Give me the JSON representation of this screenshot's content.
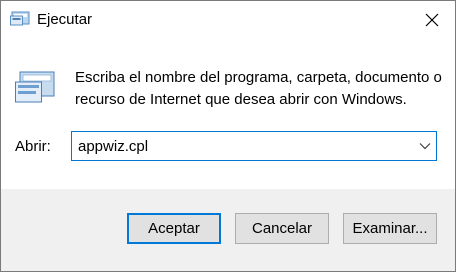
{
  "window": {
    "title": "Ejecutar",
    "title_icon": "run-dialog-icon",
    "close_icon": "close-icon"
  },
  "content": {
    "icon": "run-program-icon",
    "description": "Escriba el nombre del programa, carpeta, documento o recurso de Internet que desea abrir con Windows.",
    "open_label": "Abrir:",
    "open_value": "appwiz.cpl",
    "dropdown_icon": "chevron-down-icon"
  },
  "buttons": {
    "ok": "Aceptar",
    "cancel": "Cancelar",
    "browse": "Examinar..."
  },
  "colors": {
    "accent": "#0078d7",
    "footer_bg": "#f0f0f0",
    "button_bg": "#e1e1e1"
  }
}
